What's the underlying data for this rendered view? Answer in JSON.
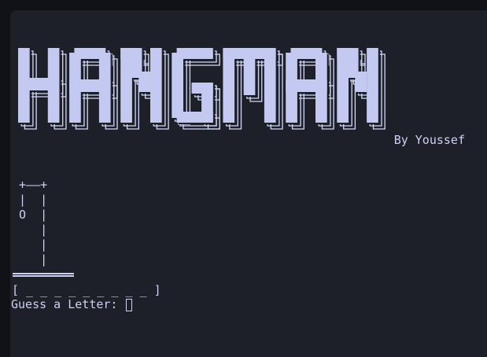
{
  "app": {
    "banner_title": "HANGMAN",
    "author": "By Youssef"
  },
  "game": {
    "gallows_top": " +——+",
    "gallows_rows": [
      " |  |",
      " O  |",
      "    |",
      "    |",
      "    |"
    ],
    "word_display": "[ _ _ _ _ _ _ _ _ _ ]",
    "prompt": "Guess a Letter: ",
    "input_value": ""
  },
  "colors": {
    "window_bg": "#1d1f29",
    "desktop_bg": "#111217",
    "text": "#cdd2f2",
    "banner_fill": "#c4c9f2"
  }
}
